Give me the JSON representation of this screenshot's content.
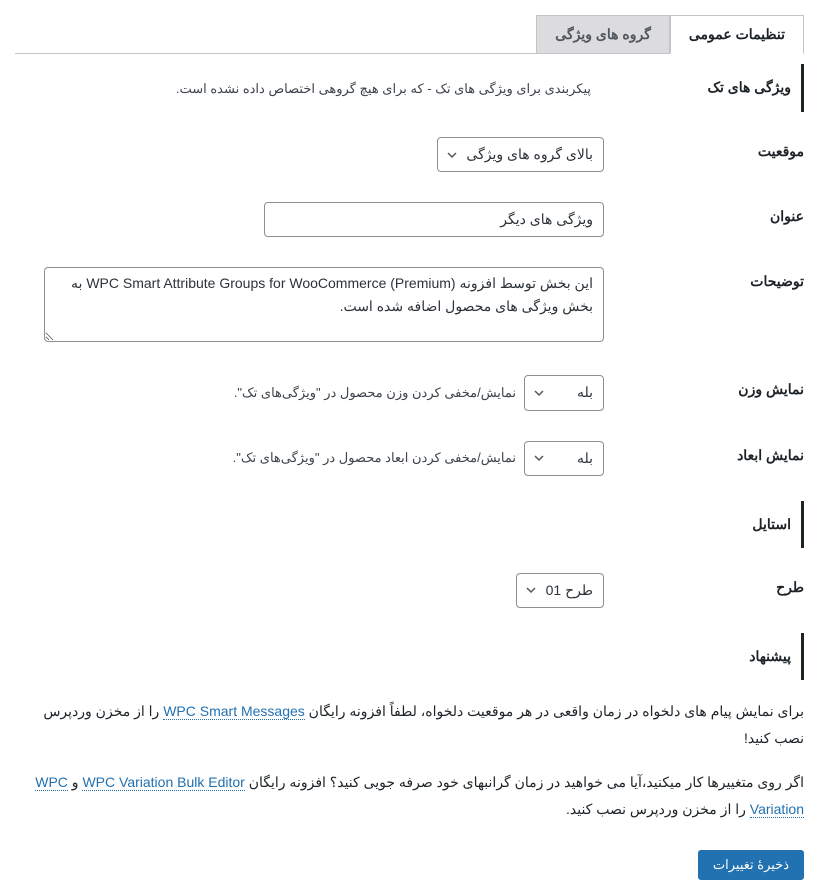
{
  "tabs": {
    "general": "تنظیمات عمومی",
    "groups": "گروه های ویژگی"
  },
  "sections": {
    "single_attrs": {
      "title": "ویژگی های تک",
      "desc": "پیکربندی برای ویژگی های تک - که برای هیچ گروهی اختصاص داده نشده است."
    },
    "style": {
      "title": "استایل"
    },
    "suggestion": {
      "title": "پیشنهاد"
    }
  },
  "fields": {
    "position": {
      "label": "موقعیت",
      "value": "بالای گروه های ویژگی"
    },
    "title": {
      "label": "عنوان",
      "value": "ویژگی های دیگر"
    },
    "description": {
      "label": "توضیحات",
      "value": "این بخش توسط افزونه WPC Smart Attribute Groups for WooCommerce (Premium) به بخش ویژگی های محصول اضافه شده است."
    },
    "show_weight": {
      "label": "نمایش وزن",
      "value": "بله",
      "desc": "نمایش/مخفی کردن وزن محصول در \"ویژگی‌های تک\"."
    },
    "show_dimensions": {
      "label": "نمایش ابعاد",
      "value": "بله",
      "desc": "نمایش/مخفی کردن ابعاد محصول در \"ویژگی‌های تک\"."
    },
    "layout": {
      "label": "طرح",
      "value": "طرح 01"
    }
  },
  "promo": {
    "p1_a": "برای نمایش پیام های دلخواه در زمان واقعی در هر موقعیت دلخواه، لطفاً افزونه رایگان ",
    "p1_link": "WPC Smart Messages",
    "p1_b": " را از مخزن وردپرس نصب کنید!",
    "p2_a": "اگر روی متغییرها کار میکنید،آیا می خواهید در زمان گرانبهای خود صرفه جویی کنید؟ افزونه رایگان ",
    "p2_link1": "WPC Variation Bulk Editor",
    "p2_and": " و ",
    "p2_link2": "WPC Variation",
    "p2_b": " را از مخزن وردپرس نصب کنید."
  },
  "save_button": "ذخیرهٔ تغییرات"
}
